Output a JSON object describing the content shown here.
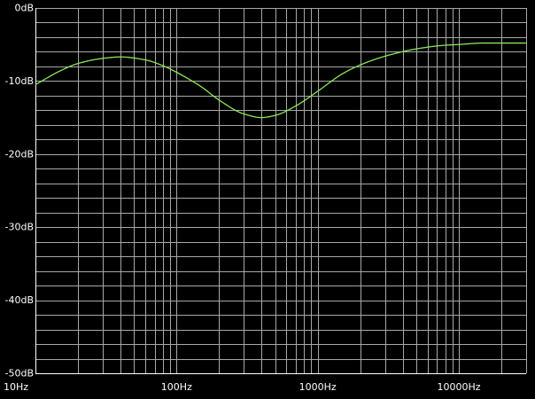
{
  "chart_data": {
    "type": "line",
    "x_scale": "log",
    "xlim": [
      10,
      30000
    ],
    "ylim": [
      -50,
      0
    ],
    "grid": true,
    "xlabel": "",
    "ylabel": "",
    "title": "",
    "y_ticks": [
      {
        "value": 0,
        "label": "0dB"
      },
      {
        "value": -10,
        "label": "-10dB"
      },
      {
        "value": -20,
        "label": "-20dB"
      },
      {
        "value": -30,
        "label": "-30dB"
      },
      {
        "value": -40,
        "label": "-40dB"
      },
      {
        "value": -50,
        "label": "-50dB"
      }
    ],
    "x_ticks": [
      {
        "value": 10,
        "label": "10Hz"
      },
      {
        "value": 100,
        "label": "100Hz"
      },
      {
        "value": 1000,
        "label": "1000Hz"
      },
      {
        "value": 10000,
        "label": "10000Hz"
      }
    ],
    "colors": {
      "background": "#000000",
      "grid": "#a8a8a8",
      "axis": "#ffffff",
      "line": "#8be65a"
    },
    "series": [
      {
        "x": [
          10,
          15,
          20,
          30,
          40,
          60,
          80,
          100,
          150,
          200,
          300,
          400,
          500,
          700,
          1000,
          1500,
          2000,
          3000,
          5000,
          8000,
          10000,
          15000,
          20000,
          30000
        ],
        "values": [
          -10.5,
          -8.6,
          -7.6,
          -6.9,
          -6.7,
          -7.1,
          -7.9,
          -8.8,
          -10.8,
          -12.6,
          -14.5,
          -15.0,
          -14.7,
          -13.4,
          -11.4,
          -9.0,
          -7.8,
          -6.6,
          -5.6,
          -5.1,
          -5.0,
          -4.8,
          -4.8,
          -4.8
        ]
      }
    ]
  }
}
